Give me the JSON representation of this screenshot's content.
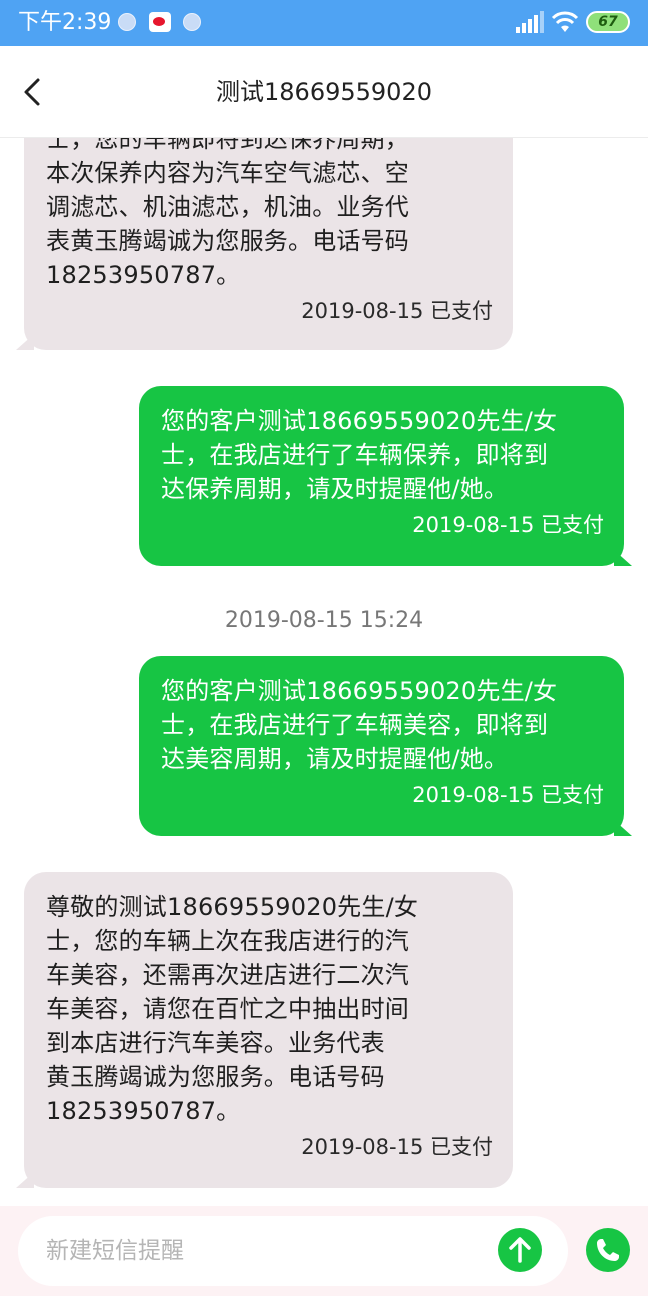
{
  "status_bar": {
    "time": "下午2:39",
    "battery": "67",
    "icons": [
      "notification-dot-icon",
      "weibo-icon",
      "notification-dot-icon",
      "signal-icon",
      "wifi-icon",
      "battery-icon"
    ]
  },
  "header": {
    "title": "测试18669559020"
  },
  "messages": [
    {
      "direction": "incoming",
      "text": "士，您的车辆即将到达保养周期，\n本次保养内容为汽车空气滤芯、空\n调滤芯、机油滤芯，机油。业务代\n表黄玉腾竭诚为您服务。电话号码\n18253950787。",
      "meta": "2019-08-15  已支付"
    },
    {
      "direction": "outgoing",
      "text": "您的客户测试18669559020先生/女\n士，在我店进行了车辆保养，即将到\n达保养周期，请及时提醒他/她。",
      "meta": "2019-08-15  已支付"
    },
    {
      "direction": "outgoing",
      "text": "您的客户测试18669559020先生/女\n士，在我店进行了车辆美容，即将到\n达美容周期，请及时提醒他/她。",
      "meta": "2019-08-15  已支付"
    },
    {
      "direction": "incoming",
      "text": "尊敬的测试18669559020先生/女\n士，您的车辆上次在我店进行的汽\n车美容，还需再次进店进行二次汽\n车美容，请您在百忙之中抽出时间\n到本店进行汽车美容。业务代表\n黄玉腾竭诚为您服务。电话号码\n18253950787。",
      "meta": "2019-08-15  已支付"
    }
  ],
  "timestamp_divider": "2019-08-15 15:24",
  "composer": {
    "placeholder": "新建短信提醒"
  },
  "colors": {
    "status_bar": "#4fa3f3",
    "incoming_bubble": "#ebe4e7",
    "outgoing_bubble": "#17c544",
    "composer_bg": "#fdf2f4"
  }
}
